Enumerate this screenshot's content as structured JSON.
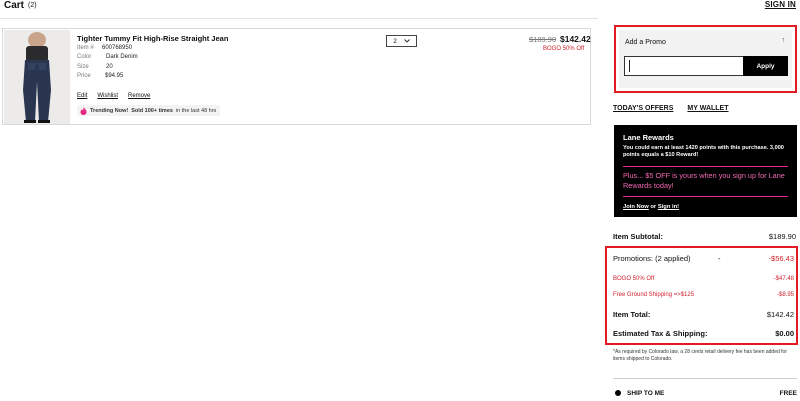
{
  "header": {
    "title": "Cart",
    "count": "(2)",
    "sign_in": "SIGN IN"
  },
  "item": {
    "name": "Tighter Tummy Fit High-Rise Straight Jean",
    "attrs": [
      {
        "label": "Item #",
        "value": "600768950"
      },
      {
        "label": "Color",
        "value": "Dark Denim"
      },
      {
        "label": "Size",
        "value": "20"
      },
      {
        "label": "Price",
        "value": "$94.95"
      }
    ],
    "actions": [
      "Edit",
      "Wishlist",
      "Remove"
    ],
    "trending_label": "Trending Now!",
    "trending_text": "Sold 100+ times",
    "trending_suffix": "in the last 48 hrs",
    "quantity": "2",
    "original_price": "$189.90",
    "price": "$142.42",
    "promo_tag": "BOGO 50% Off"
  },
  "promo": {
    "title": "Add a Promo",
    "input_value": "",
    "apply_label": "Apply"
  },
  "tabs": [
    "TODAY'S OFFERS",
    "MY WALLET"
  ],
  "rewards": {
    "title": "Lane Rewards",
    "desc": "You could earn at least 1420 points with this purchase. 3,000 points equals a $10 Reward!",
    "plus": "Plus... $5 OFF is yours when you sign up for Lane Rewards today!",
    "join_label": "Join Now",
    "or_label": "or",
    "signin_label": "Sign in!"
  },
  "summary": {
    "subtotal_label": "Item Subtotal:",
    "subtotal_value": "$189.90",
    "promotions_label": "Promotions: (2 applied)",
    "promotions_dash": "-",
    "promotions_value": "-$56.43",
    "promos": [
      {
        "label": "BOGO 50% Off",
        "value": "-$47.48"
      },
      {
        "label": "Free Ground Shipping =>$125",
        "value": "-$8.95"
      }
    ],
    "total_label": "Item Total:",
    "total_value": "$142.42",
    "tax_label": "Estimated Tax & Shipping:",
    "tax_value": "$0.00"
  },
  "footnote": "*As required by Colorado law, a 28 cents retail delivery fee has been added for items shipped to Colorado.",
  "shipping": {
    "label": "SHIP TO ME",
    "value": "FREE"
  },
  "colors": {
    "accent_red": "#e31b23",
    "promo_red": "#d11e2b",
    "rewards_pink": "#f268b4",
    "rewards_bg": "#000000"
  }
}
